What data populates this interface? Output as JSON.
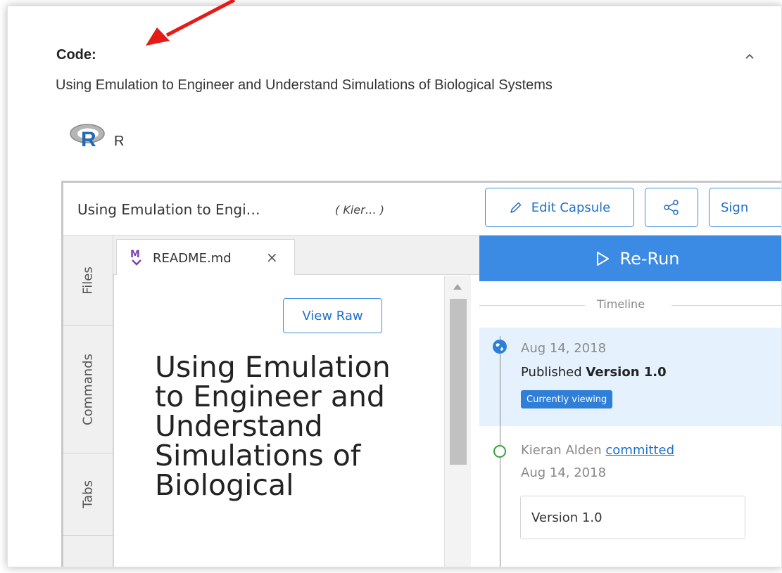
{
  "section": {
    "heading": "Code:",
    "title": "Using Emulation to Engineer and Understand Simulations of Biological Systems",
    "language": {
      "label": "R",
      "logo_icon": "r-logo-icon"
    },
    "collapse_icon": "chevron-up-icon"
  },
  "capsule": {
    "title": "Using Emulation to Engi…",
    "author": "( Kier… )",
    "buttons": {
      "edit": "Edit Capsule",
      "share_icon": "share-icon",
      "sign": "Sign"
    },
    "side_tabs": [
      "Files",
      "Commands",
      "Tabs"
    ],
    "editor": {
      "file_tab": "README.md",
      "close_symbol": "×",
      "view_raw": "View Raw",
      "readme_heading": "Using Emulation to Engineer and Understand Simulations of Biological"
    },
    "timeline": {
      "rerun": "Re-Run",
      "label": "Timeline",
      "events": {
        "published": {
          "date": "Aug 14, 2018",
          "prefix": "Published",
          "version": "Version 1.0",
          "badge": "Currently viewing"
        },
        "commit": {
          "author": "Kieran Alden",
          "action": "committed",
          "date": "Aug 14, 2018",
          "message": "Version 1.0"
        }
      }
    }
  },
  "colors": {
    "accent_blue": "#3b8ae3",
    "link_blue": "#1e6fcc",
    "annotation_red": "#e41b17",
    "highlight_bg": "#e5f2fd",
    "commit_green": "#3aa040"
  }
}
